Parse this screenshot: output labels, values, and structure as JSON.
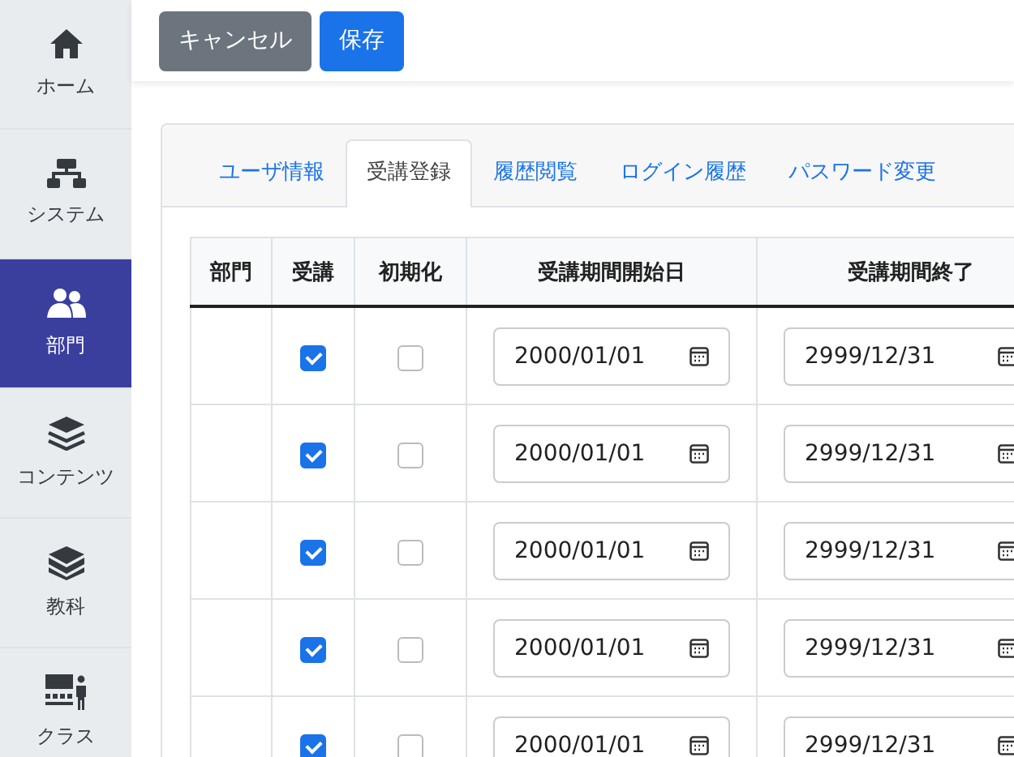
{
  "sidebar": {
    "items": [
      {
        "kind": "home",
        "label": "ホーム",
        "selected": false
      },
      {
        "kind": "system",
        "label": "システム",
        "selected": false
      },
      {
        "kind": "users",
        "label": "部門",
        "selected": true
      },
      {
        "kind": "layers",
        "label": "コンテンツ",
        "selected": false
      },
      {
        "kind": "books",
        "label": "教科",
        "selected": false
      },
      {
        "kind": "class",
        "label": "クラス",
        "selected": false
      }
    ]
  },
  "toolbar": {
    "buttons": [
      {
        "kind": "secondary",
        "label": "キャンセル"
      },
      {
        "kind": "primary",
        "label": "保存"
      }
    ]
  },
  "tabs": [
    {
      "label": "ユーザ情報",
      "selected": false
    },
    {
      "label": "受講登録",
      "selected": true
    },
    {
      "label": "履歴閲覧",
      "selected": false
    },
    {
      "label": "ログイン履歴",
      "selected": false
    },
    {
      "label": "パスワード変更",
      "selected": false
    }
  ],
  "table": {
    "columns": [
      "部門",
      "受講",
      "初期化",
      "受講期間開始日",
      "受講期間終了"
    ],
    "rows": [
      {
        "enrolled": true,
        "reset": false,
        "start": "2000/01/01",
        "end": "2999/12/31"
      },
      {
        "enrolled": true,
        "reset": false,
        "start": "2000/01/01",
        "end": "2999/12/31"
      },
      {
        "enrolled": true,
        "reset": false,
        "start": "2000/01/01",
        "end": "2999/12/31"
      },
      {
        "enrolled": true,
        "reset": false,
        "start": "2000/01/01",
        "end": "2999/12/31"
      },
      {
        "enrolled": true,
        "reset": false,
        "start": "2000/01/01",
        "end": "2999/12/31"
      }
    ]
  }
}
